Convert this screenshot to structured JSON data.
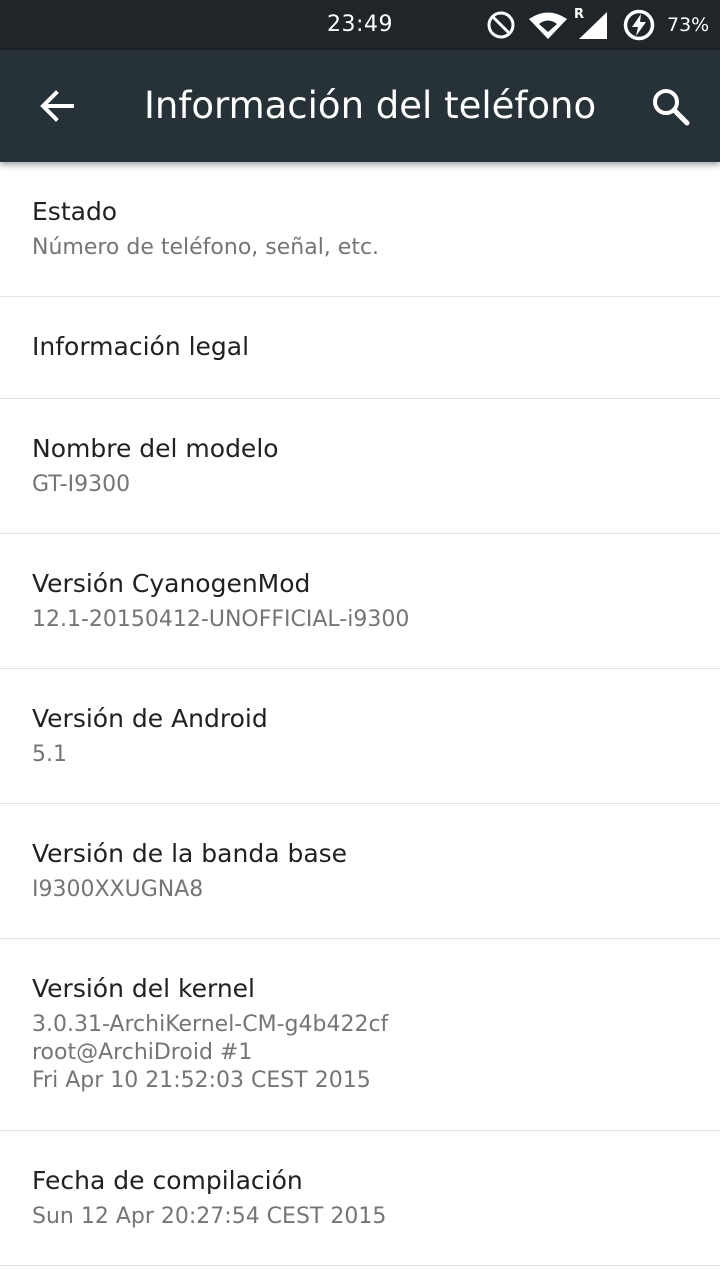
{
  "status_bar": {
    "time": "23:49",
    "battery_percent": "73%",
    "icons": [
      "do-not-disturb-icon",
      "wifi-icon",
      "cell-signal-icon",
      "roaming-indicator",
      "battery-charging-icon"
    ],
    "roaming_label": "R"
  },
  "app_bar": {
    "title": "Información del teléfono",
    "back_icon": "back-arrow-icon",
    "search_icon": "search-icon",
    "background": "#263238"
  },
  "items": [
    {
      "title": "Estado",
      "summary": "Número de teléfono, señal, etc."
    },
    {
      "title": "Información legal"
    },
    {
      "title": "Nombre del modelo",
      "summary": "GT-I9300"
    },
    {
      "title": "Versión CyanogenMod",
      "summary": "12.1-20150412-UNOFFICIAL-i9300"
    },
    {
      "title": "Versión de Android",
      "summary": "5.1"
    },
    {
      "title": "Versión de la banda base",
      "summary": "I9300XXUGNA8"
    },
    {
      "title": "Versión del kernel",
      "summary_lines": [
        "3.0.31-ArchiKernel-CM-g4b422cf",
        "root@ArchiDroid #1",
        "Fri Apr 10 21:52:03 CEST 2015"
      ]
    },
    {
      "title": "Fecha de compilación",
      "summary": "Sun 12 Apr 20:27:54 CEST 2015"
    }
  ]
}
